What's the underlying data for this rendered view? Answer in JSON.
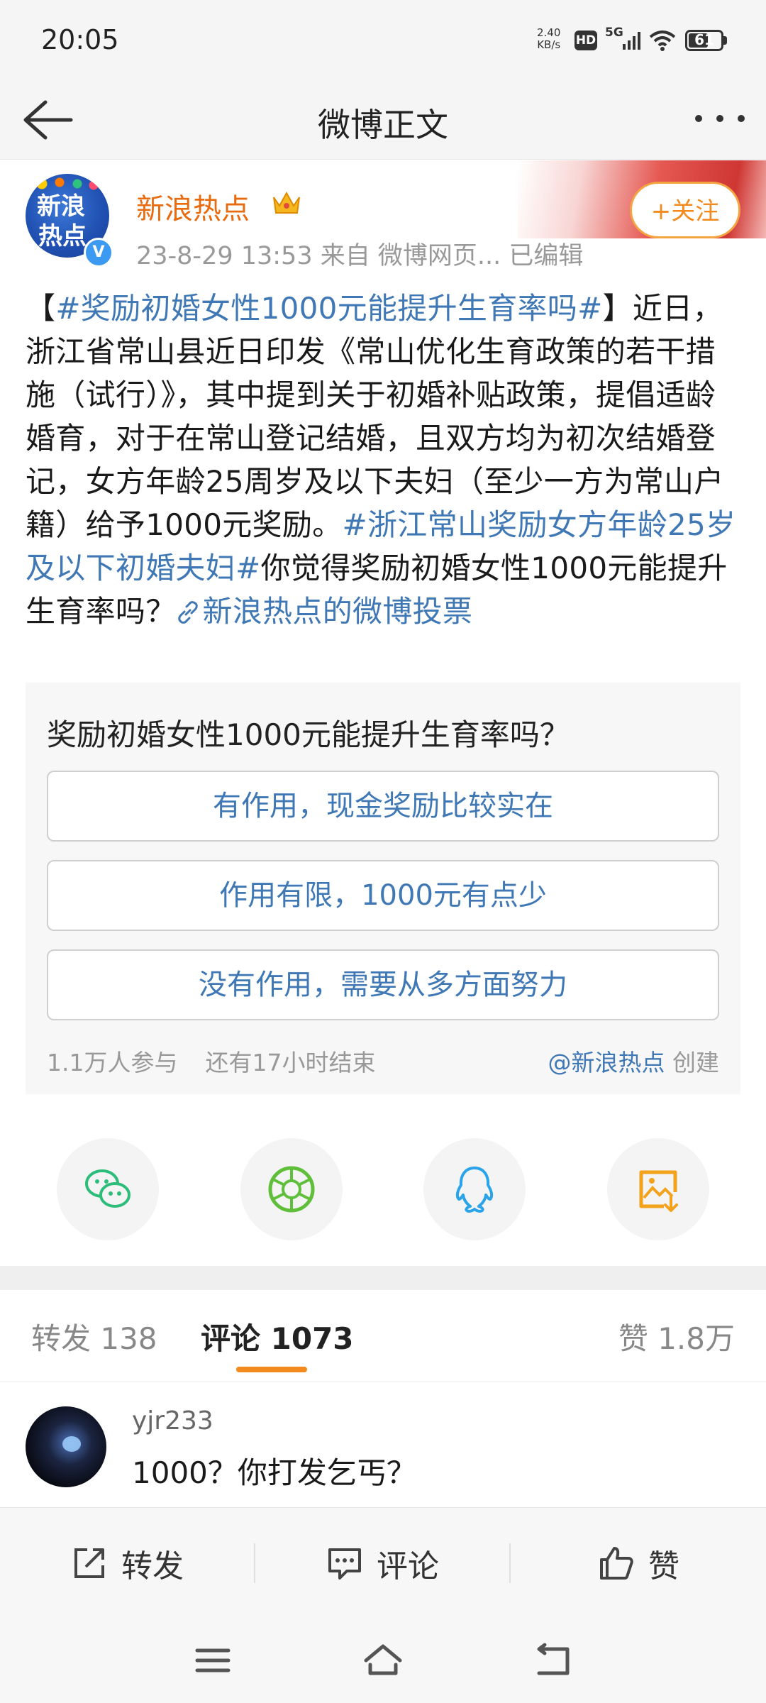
{
  "status_bar": {
    "time": "20:05",
    "net_speed_value": "2.40",
    "net_speed_unit": "KB/s",
    "hd": "HD",
    "network": "5G",
    "battery": "61",
    "battery_level": 0.61
  },
  "nav": {
    "title": "微博正文",
    "back_icon": "back-arrow-icon",
    "more_icon": "more-dots-icon"
  },
  "author": {
    "avatar_text_line1": "新浪",
    "avatar_text_line2": "热点",
    "verified_badge": "V",
    "name": "新浪热点",
    "meta": "23-8-29 13:53   来自 微博网页...   已编辑",
    "follow_label": "+关注",
    "crown_icon": "crown-icon"
  },
  "post": {
    "segments": [
      {
        "type": "text",
        "text": "【"
      },
      {
        "type": "tag",
        "text": "#奖励初婚女性1000元能提升生育率吗#"
      },
      {
        "type": "text",
        "text": "】近日，浙江省常山县近日印发《常山优化生育政策的若干措施（试行）》，其中提到关于初婚补贴政策，提倡适龄婚育，对于在常山登记结婚，且双方均为初次结婚登记，女方年龄25周岁及以下夫妇（至少一方为常山户籍）给予1000元奖励。"
      },
      {
        "type": "tag",
        "text": "#浙江常山奖励女方年龄25岁及以下初婚夫妇#"
      },
      {
        "type": "text",
        "text": "你觉得奖励初婚女性1000元能提升生育率吗？"
      },
      {
        "type": "link",
        "text": "新浪热点的微博投票"
      }
    ]
  },
  "poll": {
    "question": "奖励初婚女性1000元能提升生育率吗？",
    "options": [
      "有作用，现金奖励比较实在",
      "作用有限，1000元有点少",
      "没有作用，需要从多方面努力"
    ],
    "participants": "1.1万人参与",
    "remaining": "还有17小时结束",
    "creator": "@新浪热点",
    "creator_suffix": " 创建"
  },
  "share": [
    {
      "name": "wechat",
      "icon": "wechat-icon",
      "color": "#2dbd7a"
    },
    {
      "name": "moments",
      "icon": "moments-icon",
      "color": "#5fbf3a"
    },
    {
      "name": "qq",
      "icon": "qq-icon",
      "color": "#29a3ea"
    },
    {
      "name": "save-image",
      "icon": "save-image-icon",
      "color": "#f2a21b"
    }
  ],
  "tabs": {
    "repost": "转发 138",
    "comment": "评论 1073",
    "like": "赞 1.8万"
  },
  "comment": {
    "user": "yjr233",
    "text": "1000？你打发乞丐？"
  },
  "actions": {
    "repost": "转发",
    "comment": "评论",
    "like": "赞"
  },
  "colors": {
    "accent": "#f28a1e",
    "link": "#3f78b5",
    "author": "#e86b10"
  }
}
